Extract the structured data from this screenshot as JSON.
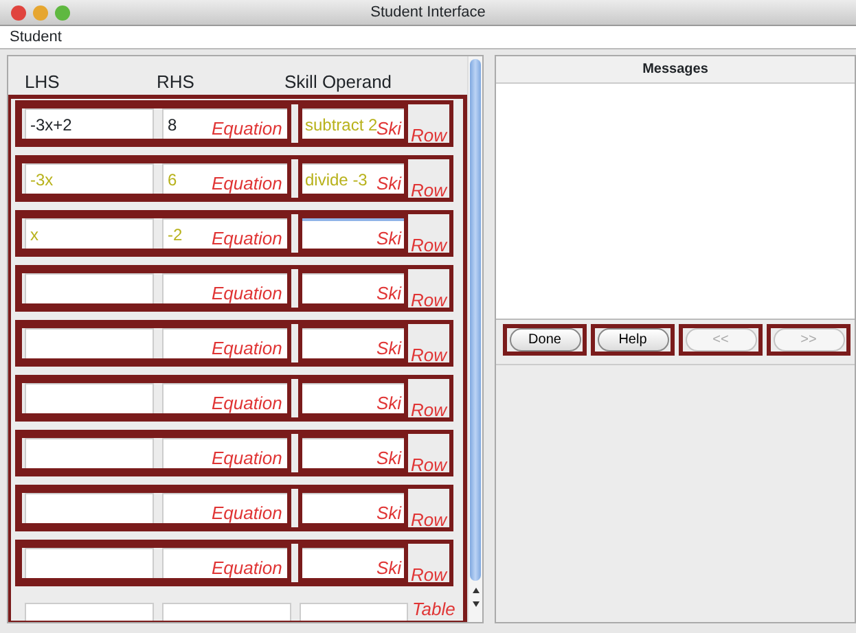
{
  "window": {
    "title": "Student Interface"
  },
  "menu": [
    "Student"
  ],
  "table": {
    "columns": [
      "LHS",
      "RHS",
      "Skill Operand"
    ],
    "annotation": "Table",
    "rows": [
      {
        "annotations": {
          "equation": "Equation",
          "skill": "Ski",
          "row": "Row"
        },
        "cells": [
          {
            "text": "-3x+2",
            "correct": false,
            "focused": false
          },
          {
            "text": "8",
            "correct": false,
            "focused": false
          },
          {
            "text": "subtract 2",
            "correct": true,
            "focused": false
          }
        ]
      },
      {
        "annotations": {
          "equation": "Equation",
          "skill": "Ski",
          "row": "Row"
        },
        "cells": [
          {
            "text": "-3x",
            "correct": true,
            "focused": false
          },
          {
            "text": "6",
            "correct": true,
            "focused": false
          },
          {
            "text": "divide -3",
            "correct": true,
            "focused": false
          }
        ]
      },
      {
        "annotations": {
          "equation": "Equation",
          "skill": "Ski",
          "row": "Row"
        },
        "cells": [
          {
            "text": "x",
            "correct": true,
            "focused": false
          },
          {
            "text": "-2",
            "correct": true,
            "focused": false
          },
          {
            "focused": true
          }
        ]
      },
      {
        "annotations": {
          "equation": "Equation",
          "skill": "Ski",
          "row": "Row"
        },
        "cells": [
          {
            "focused": false
          },
          {
            "focused": false
          },
          {
            "focused": false
          }
        ]
      },
      {
        "annotations": {
          "equation": "Equation",
          "skill": "Ski",
          "row": "Row"
        },
        "cells": [
          {
            "focused": false
          },
          {
            "focused": false
          },
          {
            "focused": false
          }
        ]
      },
      {
        "annotations": {
          "equation": "Equation",
          "skill": "Ski",
          "row": "Row"
        },
        "cells": [
          {
            "focused": false
          },
          {
            "focused": false
          },
          {
            "focused": false
          }
        ]
      },
      {
        "annotations": {
          "equation": "Equation",
          "skill": "Ski",
          "row": "Row"
        },
        "cells": [
          {
            "focused": false
          },
          {
            "focused": false
          },
          {
            "focused": false
          }
        ]
      },
      {
        "annotations": {
          "equation": "Equation",
          "skill": "Ski",
          "row": "Row"
        },
        "cells": [
          {
            "focused": false
          },
          {
            "focused": false
          },
          {
            "focused": false
          }
        ]
      },
      {
        "annotations": {
          "equation": "Equation",
          "skill": "Ski",
          "row": "Row"
        },
        "cells": [
          {
            "focused": false
          },
          {
            "focused": false
          },
          {
            "focused": false
          }
        ]
      },
      {
        "cells": [
          {
            "focused": false
          },
          {
            "focused": false
          },
          {
            "focused": false
          }
        ]
      }
    ]
  },
  "messages": {
    "title": "Messages"
  },
  "buttons": [
    {
      "label": "Done",
      "disabled": false
    },
    {
      "label": "Help",
      "disabled": false
    },
    {
      "label": "<<",
      "disabled": true
    },
    {
      "label": ">>",
      "disabled": true
    }
  ]
}
